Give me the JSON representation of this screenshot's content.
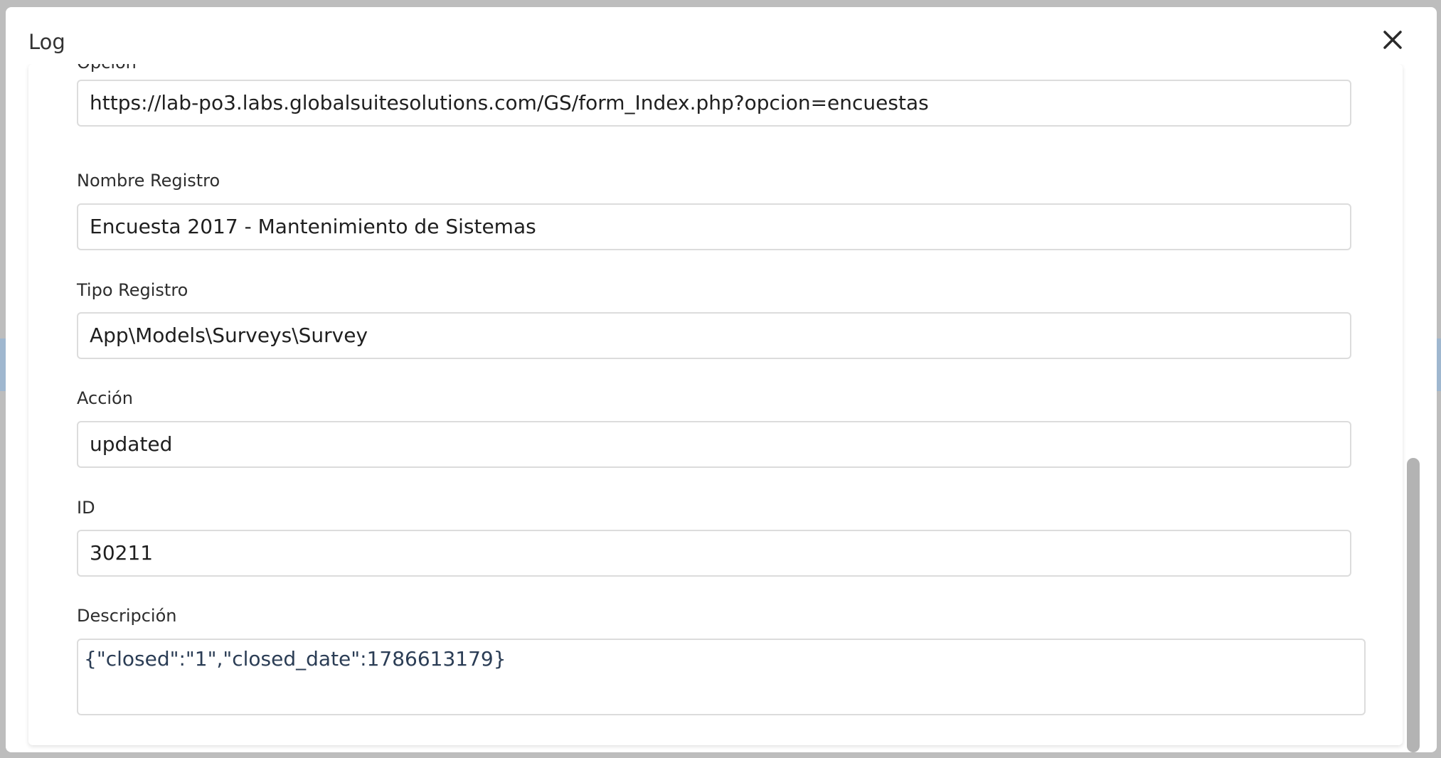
{
  "modal": {
    "title": "Log",
    "close_icon": "close-icon"
  },
  "fields": {
    "opcion": {
      "label": "Opción",
      "value": "https://lab-po3.labs.globalsuitesolutions.com/GS/form_Index.php?opcion=encuestas"
    },
    "nombre_registro": {
      "label": "Nombre Registro",
      "value": "Encuesta 2017 - Mantenimiento de Sistemas"
    },
    "tipo_registro": {
      "label": "Tipo Registro",
      "value": "App\\Models\\Surveys\\Survey"
    },
    "accion": {
      "label": "Acción",
      "value": "updated"
    },
    "id": {
      "label": "ID",
      "value": "30211"
    },
    "descripcion": {
      "label": "Descripción",
      "value": "{\"closed\":\"1\",\"closed_date\":1786613179}"
    }
  }
}
